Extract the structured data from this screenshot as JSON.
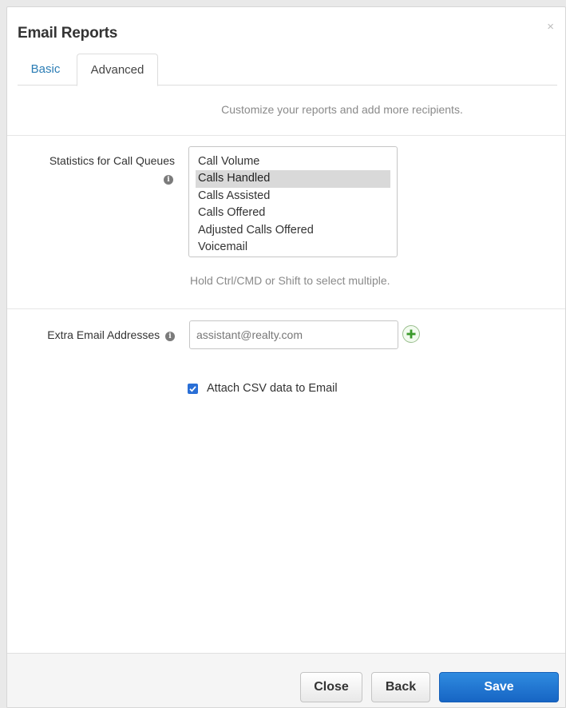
{
  "dialog": {
    "title": "Email Reports",
    "close_glyph": "×"
  },
  "tabs": [
    {
      "label": "Basic",
      "active": false
    },
    {
      "label": "Advanced",
      "active": true
    }
  ],
  "intro_text": "Customize your reports and add more recipients.",
  "statistics": {
    "label": "Statistics for Call Queues",
    "options": [
      {
        "label": "Call Volume",
        "selected": false
      },
      {
        "label": "Calls Handled",
        "selected": true
      },
      {
        "label": "Calls Assisted",
        "selected": false
      },
      {
        "label": "Calls Offered",
        "selected": false
      },
      {
        "label": "Adjusted Calls Offered",
        "selected": false
      },
      {
        "label": "Voicemail",
        "selected": false
      }
    ],
    "help_text": "Hold Ctrl/CMD or Shift to select multiple."
  },
  "extra_email": {
    "label": "Extra Email Addresses",
    "value": "assistant@realty.com",
    "add_icon": "plus-circle-icon"
  },
  "attach_csv": {
    "label": "Attach CSV data to Email",
    "checked": true
  },
  "footer": {
    "close_label": "Close",
    "back_label": "Back",
    "save_label": "Save"
  },
  "colors": {
    "accent": "#1f73d1",
    "tab_link": "#2b7db5",
    "add_icon": "#3a9a2a",
    "checkbox": "#2a6fd6"
  }
}
